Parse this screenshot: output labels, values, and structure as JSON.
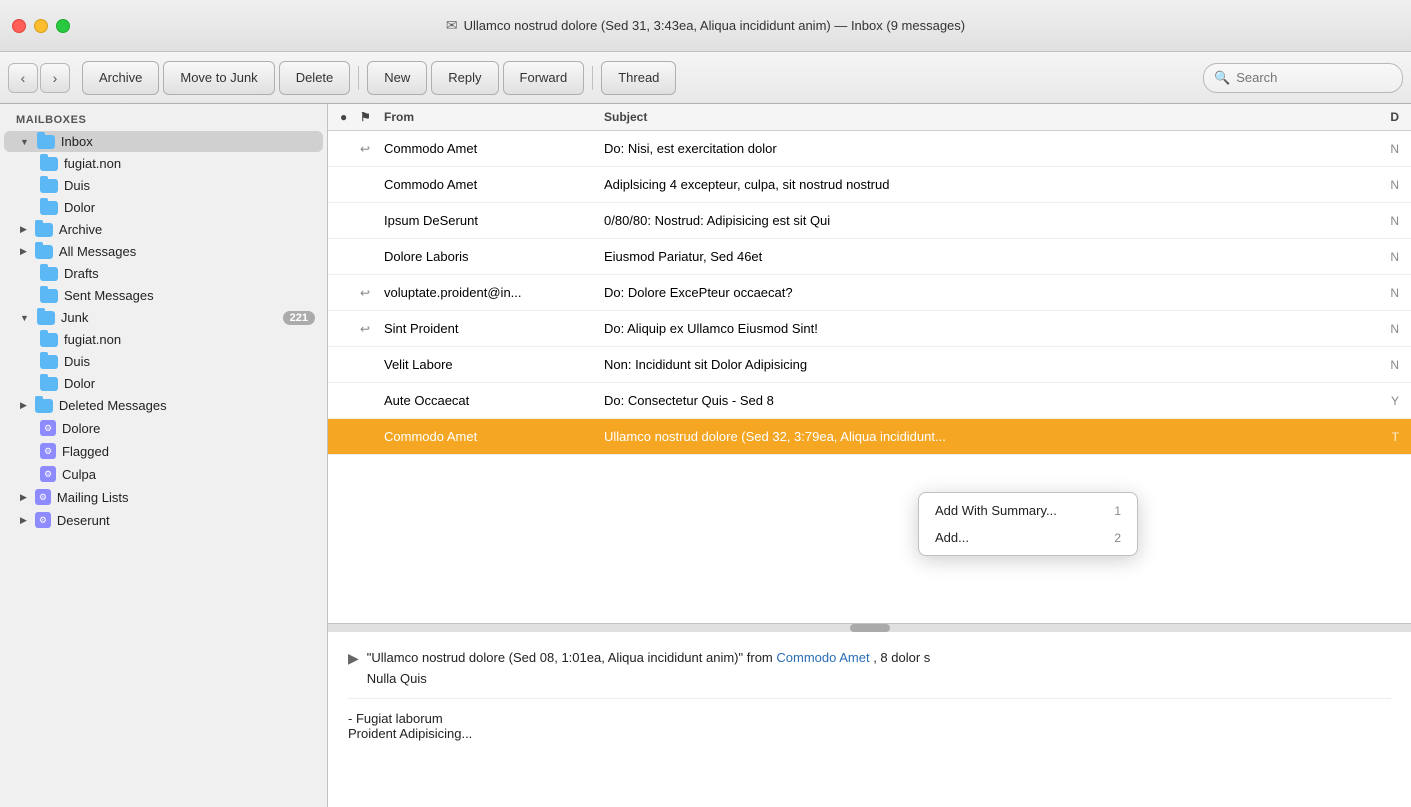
{
  "window": {
    "title": "Ullamco nostrud dolore (Sed 31, 3:43ea, Aliqua incididunt anim) — Inbox (9 messages)",
    "title_icon": "✉"
  },
  "toolbar": {
    "back_label": "‹",
    "forward_label": "›",
    "archive_label": "Archive",
    "move_to_junk_label": "Move to Junk",
    "delete_label": "Delete",
    "new_label": "New",
    "reply_label": "Reply",
    "forward_label2": "Forward",
    "thread_label": "Thread",
    "search_placeholder": "Search"
  },
  "sidebar": {
    "section_label": "MAILBOXES",
    "items": [
      {
        "label": "Inbox",
        "type": "folder",
        "indent": 0,
        "expanded": true,
        "selected": false
      },
      {
        "label": "fugiat.non",
        "type": "folder",
        "indent": 1,
        "selected": false
      },
      {
        "label": "Duis",
        "type": "folder",
        "indent": 1,
        "selected": false
      },
      {
        "label": "Dolor",
        "type": "folder",
        "indent": 1,
        "selected": false
      },
      {
        "label": "Archive",
        "type": "folder",
        "indent": 0,
        "expanded": false,
        "selected": false
      },
      {
        "label": "All Messages",
        "type": "folder",
        "indent": 0,
        "expanded": false,
        "selected": false
      },
      {
        "label": "Drafts",
        "type": "folder",
        "indent": 0,
        "selected": false
      },
      {
        "label": "Sent Messages",
        "type": "folder",
        "indent": 0,
        "selected": false
      },
      {
        "label": "Junk",
        "type": "folder",
        "indent": 0,
        "expanded": true,
        "badge": "221",
        "selected": false
      },
      {
        "label": "fugiat.non",
        "type": "folder",
        "indent": 1,
        "selected": false
      },
      {
        "label": "Duis",
        "type": "folder",
        "indent": 1,
        "selected": false
      },
      {
        "label": "Dolor",
        "type": "folder",
        "indent": 1,
        "selected": false
      },
      {
        "label": "Deleted Messages",
        "type": "folder",
        "indent": 0,
        "expanded": false,
        "selected": false
      },
      {
        "label": "Dolore",
        "type": "smart",
        "indent": 0,
        "selected": false
      },
      {
        "label": "Flagged",
        "type": "smart",
        "indent": 0,
        "selected": false
      },
      {
        "label": "Culpa",
        "type": "smart",
        "indent": 0,
        "selected": false
      },
      {
        "label": "Mailing Lists",
        "type": "smart",
        "indent": 0,
        "expanded": false,
        "selected": false
      },
      {
        "label": "Deserunt",
        "type": "smart",
        "indent": 0,
        "selected": false
      }
    ]
  },
  "email_list": {
    "columns": {
      "dot": "●",
      "flag": "⚑",
      "from": "From",
      "subject": "Subject",
      "date": "D"
    },
    "emails": [
      {
        "id": 1,
        "from": "Commodo Amet",
        "subject": "Do: Nisi, est exercitation dolor",
        "date": "N",
        "unread": false,
        "reply": true,
        "selected": false
      },
      {
        "id": 2,
        "from": "Commodo Amet",
        "subject": "Adiplsicing 4 excepteur, culpa, sit nostrud nostrud",
        "date": "N",
        "unread": false,
        "reply": false,
        "selected": false
      },
      {
        "id": 3,
        "from": "Ipsum DeSerunt",
        "subject": "0/80/80: Nostrud: Adipisicing est sit Qui",
        "date": "N",
        "unread": false,
        "reply": false,
        "selected": false
      },
      {
        "id": 4,
        "from": "Dolore Laboris",
        "subject": "Eiusmod Pariatur, Sed 46et",
        "date": "N",
        "unread": false,
        "reply": false,
        "selected": false
      },
      {
        "id": 5,
        "from": "voluptate.proident@in...",
        "subject": "Do: Dolore ExcePteur occaecat?",
        "date": "N",
        "unread": false,
        "reply": true,
        "selected": false
      },
      {
        "id": 6,
        "from": "Sint Proident",
        "subject": "Do: Aliquip ex Ullamco Eiusmod Sint!",
        "date": "N",
        "unread": false,
        "reply": true,
        "selected": false
      },
      {
        "id": 7,
        "from": "Velit Labore",
        "subject": "Non: Incididunt sit Dolor Adipisicing",
        "date": "N",
        "unread": false,
        "reply": false,
        "selected": false
      },
      {
        "id": 8,
        "from": "Aute Occaecat",
        "subject": "Do: Consectetur Quis - Sed 8",
        "date": "Y",
        "unread": false,
        "reply": false,
        "selected": false
      },
      {
        "id": 9,
        "from": "Commodo Amet",
        "subject": "Ullamco nostrud dolore (Sed 32, 3:79ea, Aliqua incididunt...",
        "date": "T",
        "unread": false,
        "reply": false,
        "selected": true
      }
    ]
  },
  "context_menu": {
    "items": [
      {
        "label": "Add With Summary...",
        "shortcut": "1"
      },
      {
        "label": "Add...",
        "shortcut": "2"
      }
    ]
  },
  "preview": {
    "arrow": "▶",
    "quote_text": "\"Ullamco nostrud dolore (Sed 08, 1:01ea, Aliqua incididunt anim)\"",
    "from_prefix": "from",
    "from_name": "Commodo Amet",
    "from_suffix": ", 8 dolor s",
    "second_line": "Nulla Quis",
    "body_line1": "- Fugiat laborum",
    "body_line2": "Proident Adipisicing..."
  }
}
